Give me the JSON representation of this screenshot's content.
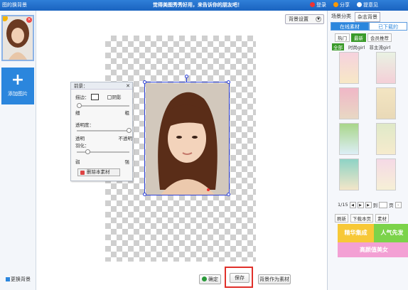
{
  "titlebar": {
    "app_title": "图的换背景",
    "slogan": "觉得美图秀秀好用，来告诉你的朋友吧！",
    "login": "登录",
    "share": "分享",
    "feedback": "提意见"
  },
  "left": {
    "add_label": "添加图片",
    "add_plus": "+",
    "change_bg": "更换背景"
  },
  "toolbar": {
    "bg_setting": "背景设置"
  },
  "panel": {
    "title": "前景：",
    "stroke_label": "描边：",
    "shadow_label": "阴影",
    "thin": "细",
    "thick": "粗",
    "opacity_label": "透明度：",
    "transparent": "透明",
    "opaque": "不透明",
    "feather_label": "羽化：",
    "weak": "弱",
    "strong": "强",
    "delete_btn": "删除本素材",
    "close": "✕"
  },
  "bottom": {
    "ok": "确定",
    "save": "保存",
    "save_as": "背景作为素材"
  },
  "right": {
    "tabs": [
      "场景分类",
      "杂志背景"
    ],
    "subtabs": [
      "在线素材",
      "已下载的"
    ],
    "cats": [
      "热门",
      "最新",
      "会员推荐"
    ],
    "filters": [
      "全部",
      "时尚girl",
      "非主流girl"
    ],
    "page": "1/15",
    "goto_label": "到",
    "goto_suffix": "页",
    "tools": [
      "刷新",
      "下载本页",
      "素材"
    ],
    "promo_a": "精华集成",
    "promo_b": "人气先发",
    "promo_c": "高颜值美女"
  },
  "colors": {
    "accent": "#2b86dd",
    "selection": "#2b3fd8",
    "save_highlight": "#e0302a"
  }
}
